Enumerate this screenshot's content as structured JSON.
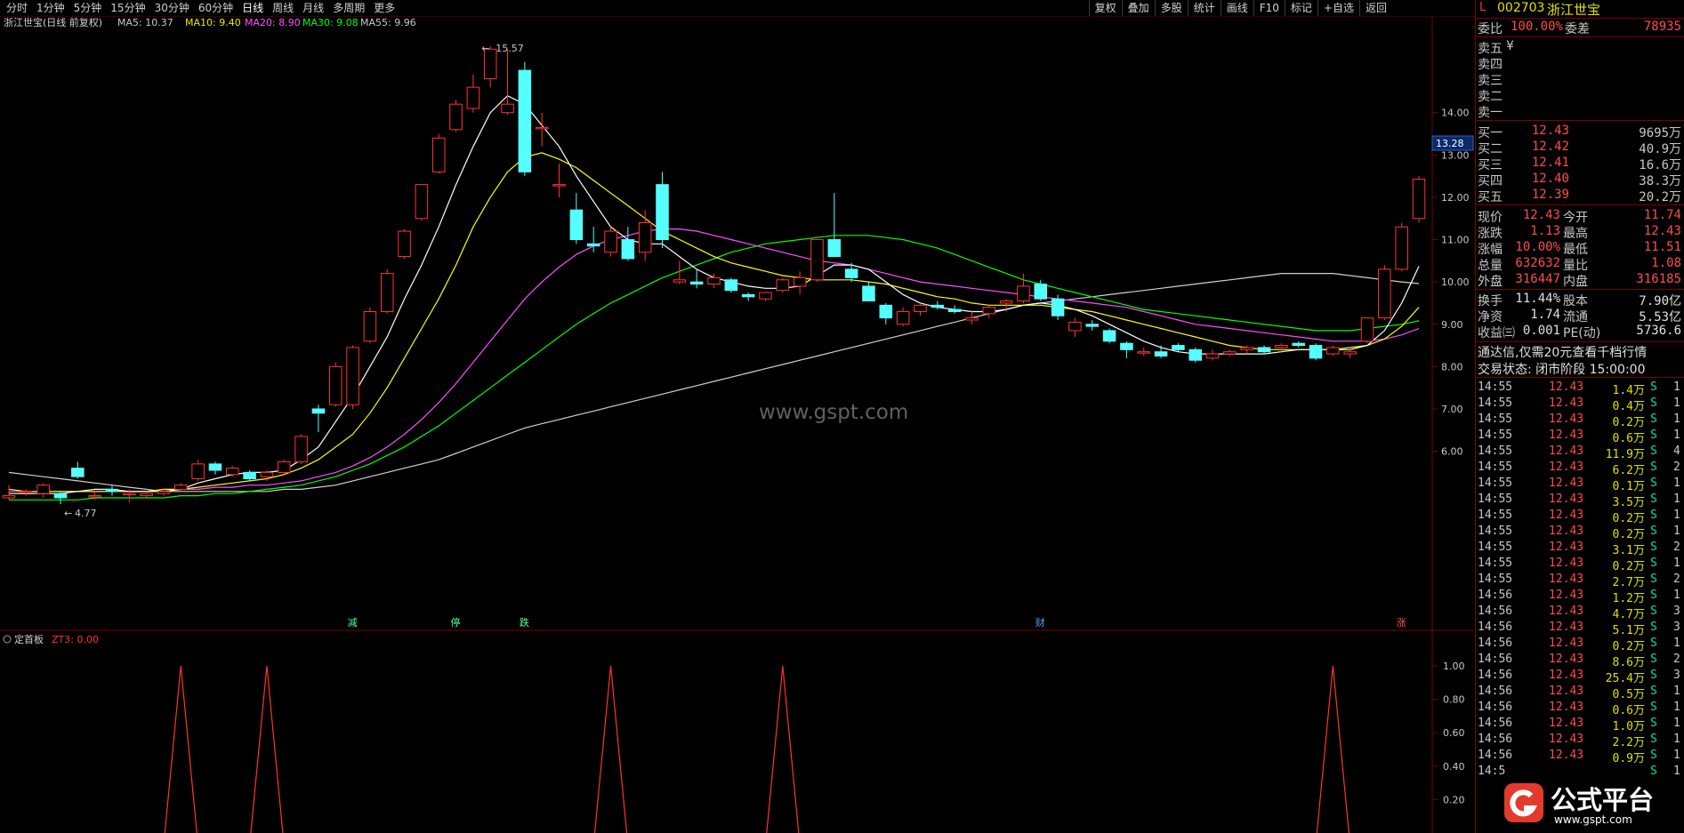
{
  "toolbar": {
    "periods": [
      "分时",
      "1分钟",
      "5分钟",
      "15分钟",
      "30分钟",
      "60分钟",
      "日线",
      "周线",
      "月线",
      "多周期",
      "更多"
    ],
    "active_period": "日线",
    "tools": [
      "复权",
      "叠加",
      "多股",
      "统计",
      "画线",
      "F10",
      "标记",
      "+自选",
      "返回"
    ]
  },
  "chart_header": {
    "title": "浙江世宝(日线 前复权)",
    "ma5": "MA5: 10.37",
    "ma10": "MA10: 9.40",
    "ma20": "MA20: 8.90",
    "ma30": "MA30: 9.08",
    "ma55": "MA55: 9.96"
  },
  "watermark": "www.gspt.com",
  "price_axis": [
    "14.00",
    "13.00",
    "12.00",
    "11.00",
    "10.00",
    "9.00",
    "8.00",
    "7.00",
    "6.00"
  ],
  "current_price_tag": "13.28",
  "high_label": "15.57",
  "low_label": "4.77",
  "markers": [
    "减",
    "停",
    "跌",
    "财",
    "涨"
  ],
  "indicator": {
    "name": "定首板",
    "value": "ZT3: 0.00",
    "axis": [
      "1.00",
      "0.80",
      "0.60",
      "0.40",
      "0.20"
    ]
  },
  "chart_data": {
    "type": "candlestick",
    "title": "浙江世宝(日线 前复权)",
    "candles": [
      [
        4.9,
        5.2,
        4.85,
        4.95
      ],
      [
        5.05,
        5.1,
        4.95,
        5.05
      ],
      [
        5.0,
        5.25,
        4.9,
        5.2
      ],
      [
        5.0,
        5.05,
        4.75,
        4.9
      ],
      [
        5.6,
        5.75,
        5.35,
        5.4
      ],
      [
        4.95,
        5.05,
        4.85,
        4.95
      ],
      [
        5.1,
        5.2,
        4.95,
        5.05
      ],
      [
        5.0,
        5.1,
        4.8,
        5.0
      ],
      [
        4.95,
        5.05,
        4.9,
        5.0
      ],
      [
        5.0,
        5.1,
        4.95,
        5.05
      ],
      [
        5.1,
        5.25,
        5.05,
        5.2
      ],
      [
        5.35,
        5.8,
        5.3,
        5.7
      ],
      [
        5.7,
        5.75,
        5.45,
        5.55
      ],
      [
        5.45,
        5.65,
        5.4,
        5.6
      ],
      [
        5.5,
        5.55,
        5.3,
        5.35
      ],
      [
        5.4,
        5.55,
        5.3,
        5.5
      ],
      [
        5.5,
        5.8,
        5.45,
        5.75
      ],
      [
        5.75,
        6.4,
        5.7,
        6.35
      ],
      [
        7.0,
        7.1,
        6.45,
        6.9
      ],
      [
        7.1,
        8.1,
        7.05,
        8.0
      ],
      [
        7.1,
        8.5,
        7.0,
        8.45
      ],
      [
        8.6,
        9.4,
        8.55,
        9.3
      ],
      [
        9.3,
        10.3,
        9.25,
        10.2
      ],
      [
        10.6,
        11.25,
        10.55,
        11.2
      ],
      [
        11.5,
        12.3,
        11.45,
        12.3
      ],
      [
        12.6,
        13.5,
        12.55,
        13.4
      ],
      [
        13.6,
        14.3,
        13.55,
        14.2
      ],
      [
        14.1,
        14.9,
        14.0,
        14.6
      ],
      [
        14.8,
        15.57,
        14.6,
        15.5
      ],
      [
        14.0,
        15.5,
        13.95,
        14.2
      ],
      [
        15.0,
        15.2,
        12.5,
        12.6
      ],
      [
        13.65,
        14.0,
        13.2,
        13.65
      ],
      [
        12.3,
        12.8,
        12.0,
        12.3
      ],
      [
        11.7,
        12.1,
        10.9,
        11.0
      ],
      [
        10.9,
        11.3,
        10.7,
        10.85
      ],
      [
        10.7,
        11.3,
        10.6,
        11.2
      ],
      [
        11.0,
        11.3,
        10.5,
        10.55
      ],
      [
        10.7,
        11.7,
        10.5,
        11.4
      ],
      [
        12.3,
        12.6,
        10.8,
        11.0
      ],
      [
        10.0,
        10.5,
        9.95,
        10.05
      ],
      [
        10.0,
        10.3,
        9.85,
        9.95
      ],
      [
        9.95,
        10.2,
        9.85,
        10.1
      ],
      [
        10.05,
        10.1,
        9.75,
        9.8
      ],
      [
        9.7,
        9.75,
        9.55,
        9.65
      ],
      [
        9.6,
        9.75,
        9.55,
        9.75
      ],
      [
        9.8,
        10.1,
        9.75,
        10.05
      ],
      [
        9.9,
        10.25,
        9.7,
        10.1
      ],
      [
        10.05,
        11.0,
        10.0,
        11.0
      ],
      [
        11.0,
        12.1,
        10.8,
        10.6
      ],
      [
        10.3,
        10.45,
        10.0,
        10.1
      ],
      [
        9.9,
        10.0,
        9.55,
        9.55
      ],
      [
        9.45,
        9.5,
        9.0,
        9.15
      ],
      [
        9.0,
        9.4,
        8.95,
        9.3
      ],
      [
        9.3,
        9.5,
        9.2,
        9.45
      ],
      [
        9.45,
        9.55,
        9.35,
        9.4
      ],
      [
        9.35,
        9.45,
        9.25,
        9.3
      ],
      [
        9.1,
        9.3,
        9.0,
        9.15
      ],
      [
        9.25,
        9.45,
        9.15,
        9.4
      ],
      [
        9.5,
        9.6,
        9.3,
        9.55
      ],
      [
        9.55,
        10.2,
        9.5,
        9.9
      ],
      [
        9.95,
        10.05,
        9.55,
        9.6
      ],
      [
        9.6,
        9.7,
        9.1,
        9.2
      ],
      [
        8.85,
        9.15,
        8.7,
        9.05
      ],
      [
        9.0,
        9.1,
        8.85,
        8.95
      ],
      [
        8.85,
        8.9,
        8.55,
        8.6
      ],
      [
        8.55,
        8.6,
        8.2,
        8.4
      ],
      [
        8.35,
        8.45,
        8.25,
        8.35
      ],
      [
        8.35,
        8.5,
        8.2,
        8.25
      ],
      [
        8.5,
        8.55,
        8.35,
        8.4
      ],
      [
        8.4,
        8.45,
        8.1,
        8.15
      ],
      [
        8.2,
        8.4,
        8.15,
        8.3
      ],
      [
        8.3,
        8.4,
        8.25,
        8.35
      ],
      [
        8.4,
        8.5,
        8.3,
        8.45
      ],
      [
        8.45,
        8.5,
        8.3,
        8.35
      ],
      [
        8.45,
        8.55,
        8.35,
        8.5
      ],
      [
        8.55,
        8.6,
        8.45,
        8.5
      ],
      [
        8.5,
        8.55,
        8.15,
        8.2
      ],
      [
        8.3,
        8.5,
        8.25,
        8.45
      ],
      [
        8.3,
        8.4,
        8.2,
        8.35
      ],
      [
        8.6,
        9.0,
        8.55,
        9.15
      ],
      [
        9.15,
        10.4,
        9.1,
        10.3
      ],
      [
        10.3,
        11.4,
        10.25,
        11.3
      ],
      [
        11.5,
        12.5,
        11.4,
        12.43
      ]
    ],
    "ma5": [
      5.0,
      5.0,
      5.0,
      5.0,
      5.05,
      5.1,
      5.1,
      5.05,
      5.05,
      5.05,
      5.1,
      5.25,
      5.35,
      5.45,
      5.5,
      5.5,
      5.55,
      5.8,
      6.1,
      6.7,
      7.3,
      8.0,
      8.7,
      9.6,
      10.4,
      11.3,
      12.3,
      13.2,
      14.0,
      14.4,
      14.2,
      13.7,
      13.2,
      12.5,
      11.9,
      11.3,
      11.0,
      10.9,
      10.9,
      10.6,
      10.3,
      10.1,
      10.0,
      9.9,
      9.85,
      9.85,
      9.9,
      10.15,
      10.4,
      10.4,
      10.3,
      10.0,
      9.7,
      9.5,
      9.4,
      9.35,
      9.3,
      9.3,
      9.35,
      9.45,
      9.5,
      9.45,
      9.35,
      9.2,
      9.0,
      8.8,
      8.6,
      8.45,
      8.35,
      8.3,
      8.3,
      8.3,
      8.3,
      8.3,
      8.35,
      8.4,
      8.4,
      8.4,
      8.4,
      8.5,
      8.85,
      9.5,
      10.37
    ],
    "ma10": [
      5.1,
      5.05,
      5.05,
      5.05,
      5.05,
      5.05,
      5.05,
      5.05,
      5.05,
      5.1,
      5.1,
      5.15,
      5.2,
      5.25,
      5.3,
      5.35,
      5.45,
      5.6,
      5.8,
      6.1,
      6.4,
      6.9,
      7.5,
      8.2,
      8.9,
      9.6,
      10.4,
      11.3,
      12.0,
      12.6,
      12.95,
      13.05,
      12.9,
      12.7,
      12.4,
      12.1,
      11.8,
      11.5,
      11.2,
      11.0,
      10.8,
      10.6,
      10.45,
      10.35,
      10.25,
      10.15,
      10.1,
      10.05,
      10.05,
      10.05,
      10.0,
      9.95,
      9.85,
      9.75,
      9.65,
      9.6,
      9.5,
      9.45,
      9.45,
      9.45,
      9.45,
      9.4,
      9.35,
      9.3,
      9.2,
      9.1,
      9.0,
      8.9,
      8.8,
      8.7,
      8.6,
      8.5,
      8.45,
      8.4,
      8.4,
      8.4,
      8.4,
      8.4,
      8.45,
      8.5,
      8.65,
      8.95,
      9.4
    ],
    "ma20": [
      5.05,
      5.05,
      5.05,
      5.05,
      5.05,
      5.05,
      5.05,
      5.05,
      5.05,
      5.05,
      5.1,
      5.1,
      5.15,
      5.15,
      5.2,
      5.2,
      5.25,
      5.3,
      5.4,
      5.5,
      5.65,
      5.85,
      6.1,
      6.4,
      6.75,
      7.15,
      7.6,
      8.1,
      8.6,
      9.1,
      9.6,
      10.0,
      10.35,
      10.65,
      10.85,
      11.0,
      11.1,
      11.2,
      11.25,
      11.25,
      11.2,
      11.1,
      11.0,
      10.9,
      10.8,
      10.7,
      10.6,
      10.5,
      10.45,
      10.4,
      10.3,
      10.2,
      10.1,
      10.0,
      9.95,
      9.9,
      9.85,
      9.8,
      9.75,
      9.7,
      9.65,
      9.6,
      9.55,
      9.5,
      9.45,
      9.4,
      9.3,
      9.2,
      9.1,
      9.0,
      8.95,
      8.9,
      8.85,
      8.8,
      8.75,
      8.7,
      8.65,
      8.6,
      8.6,
      8.6,
      8.65,
      8.75,
      8.9
    ],
    "ma30": [
      4.85,
      4.85,
      4.85,
      4.85,
      4.85,
      4.9,
      4.9,
      4.9,
      4.9,
      4.9,
      4.95,
      4.95,
      5.0,
      5.0,
      5.05,
      5.1,
      5.15,
      5.2,
      5.3,
      5.4,
      5.55,
      5.7,
      5.9,
      6.1,
      6.35,
      6.6,
      6.9,
      7.2,
      7.5,
      7.8,
      8.1,
      8.4,
      8.7,
      9.0,
      9.25,
      9.5,
      9.7,
      9.9,
      10.1,
      10.25,
      10.4,
      10.55,
      10.7,
      10.8,
      10.9,
      10.95,
      11.0,
      11.05,
      11.1,
      11.1,
      11.1,
      11.05,
      11.0,
      10.9,
      10.8,
      10.65,
      10.5,
      10.35,
      10.2,
      10.05,
      9.95,
      9.85,
      9.75,
      9.65,
      9.55,
      9.45,
      9.35,
      9.3,
      9.25,
      9.2,
      9.15,
      9.1,
      9.05,
      9.0,
      8.95,
      8.9,
      8.85,
      8.85,
      8.85,
      8.9,
      8.95,
      9.0,
      9.08
    ],
    "ma55": [
      5.5,
      5.45,
      5.4,
      5.35,
      5.3,
      5.25,
      5.2,
      5.15,
      5.1,
      5.05,
      5.05,
      5.05,
      5.05,
      5.05,
      5.05,
      5.05,
      5.1,
      5.1,
      5.15,
      5.2,
      5.3,
      5.4,
      5.5,
      5.6,
      5.7,
      5.8,
      5.95,
      6.1,
      6.25,
      6.4,
      6.55,
      6.65,
      6.75,
      6.85,
      6.95,
      7.05,
      7.15,
      7.25,
      7.35,
      7.45,
      7.55,
      7.65,
      7.75,
      7.85,
      7.95,
      8.05,
      8.15,
      8.25,
      8.35,
      8.45,
      8.55,
      8.65,
      8.75,
      8.85,
      8.95,
      9.05,
      9.15,
      9.25,
      9.35,
      9.45,
      9.5,
      9.55,
      9.6,
      9.65,
      9.7,
      9.75,
      9.8,
      9.85,
      9.9,
      9.95,
      10.0,
      10.05,
      10.1,
      10.15,
      10.2,
      10.2,
      10.2,
      10.2,
      10.15,
      10.1,
      10.05,
      10.0,
      9.96
    ],
    "zt3_spikes": [
      10,
      15,
      35,
      45,
      77
    ],
    "ylim": [
      4.5,
      15.8
    ]
  },
  "right_panel": {
    "header_flag": "L",
    "code": "002703",
    "name": "浙江世宝",
    "weibi_label": "委比",
    "weibi_value": "100.00%",
    "weicha_label": "委差",
    "weicha_value": "78935",
    "sell_rows": [
      {
        "label": "卖五",
        "price": "",
        "vol": ""
      },
      {
        "label": "卖四",
        "price": "",
        "vol": ""
      },
      {
        "label": "卖三",
        "price": "",
        "vol": ""
      },
      {
        "label": "卖二",
        "price": "",
        "vol": ""
      },
      {
        "label": "卖一",
        "price": "",
        "vol": ""
      }
    ],
    "sell_yen": "¥",
    "buy_rows": [
      {
        "label": "买一",
        "price": "12.43",
        "vol": "9695万"
      },
      {
        "label": "买二",
        "price": "12.42",
        "vol": "40.9万"
      },
      {
        "label": "买三",
        "price": "12.41",
        "vol": "16.6万"
      },
      {
        "label": "买四",
        "price": "12.40",
        "vol": "38.3万"
      },
      {
        "label": "买五",
        "price": "12.39",
        "vol": "20.2万"
      }
    ],
    "stats": [
      {
        "l1": "现价",
        "v1": "12.43",
        "l2": "今开",
        "v2": "11.74"
      },
      {
        "l1": "涨跌",
        "v1": "1.13",
        "l2": "最高",
        "v2": "12.43"
      },
      {
        "l1": "涨幅",
        "v1": "10.00%",
        "l2": "最低",
        "v2": "11.51"
      },
      {
        "l1": "总量",
        "v1": "632632",
        "l2": "量比",
        "v2": "1.08"
      },
      {
        "l1": "外盘",
        "v1": "316447",
        "l2": "内盘",
        "v2": "316185"
      }
    ],
    "fundamentals": [
      {
        "l1": "换手",
        "v1": "11.44%",
        "l2": "股本",
        "v2": "7.90亿"
      },
      {
        "l1": "净资",
        "v1": "1.74",
        "l2": "流通",
        "v2": "5.53亿"
      },
      {
        "l1": "收益㈢",
        "v1": "0.001",
        "l2": "PE(动)",
        "v2": "5736.6"
      }
    ],
    "promo": "通达信,仅需20元查看千档行情",
    "trade_state": "交易状态: 闭市阶段 15:00:00",
    "ticks": [
      {
        "t": "14:55",
        "p": "12.43",
        "q": "1.4万",
        "s": "S",
        "n": "1"
      },
      {
        "t": "14:55",
        "p": "12.43",
        "q": "0.4万",
        "s": "S",
        "n": "1"
      },
      {
        "t": "14:55",
        "p": "12.43",
        "q": "0.2万",
        "s": "S",
        "n": "1"
      },
      {
        "t": "14:55",
        "p": "12.43",
        "q": "0.6万",
        "s": "S",
        "n": "1"
      },
      {
        "t": "14:55",
        "p": "12.43",
        "q": "11.9万",
        "s": "S",
        "n": "4"
      },
      {
        "t": "14:55",
        "p": "12.43",
        "q": "6.2万",
        "s": "S",
        "n": "2"
      },
      {
        "t": "14:55",
        "p": "12.43",
        "q": "0.1万",
        "s": "S",
        "n": "1"
      },
      {
        "t": "14:55",
        "p": "12.43",
        "q": "3.5万",
        "s": "S",
        "n": "1"
      },
      {
        "t": "14:55",
        "p": "12.43",
        "q": "0.2万",
        "s": "S",
        "n": "1"
      },
      {
        "t": "14:55",
        "p": "12.43",
        "q": "0.2万",
        "s": "S",
        "n": "1"
      },
      {
        "t": "14:55",
        "p": "12.43",
        "q": "3.1万",
        "s": "S",
        "n": "2"
      },
      {
        "t": "14:55",
        "p": "12.43",
        "q": "0.2万",
        "s": "S",
        "n": "1"
      },
      {
        "t": "14:55",
        "p": "12.43",
        "q": "2.7万",
        "s": "S",
        "n": "2"
      },
      {
        "t": "14:56",
        "p": "12.43",
        "q": "1.2万",
        "s": "S",
        "n": "1"
      },
      {
        "t": "14:56",
        "p": "12.43",
        "q": "4.7万",
        "s": "S",
        "n": "3"
      },
      {
        "t": "14:56",
        "p": "12.43",
        "q": "5.1万",
        "s": "S",
        "n": "3"
      },
      {
        "t": "14:56",
        "p": "12.43",
        "q": "0.2万",
        "s": "S",
        "n": "1"
      },
      {
        "t": "14:56",
        "p": "12.43",
        "q": "8.6万",
        "s": "S",
        "n": "2"
      },
      {
        "t": "14:56",
        "p": "12.43",
        "q": "25.4万",
        "s": "S",
        "n": "3"
      },
      {
        "t": "14:56",
        "p": "12.43",
        "q": "0.5万",
        "s": "S",
        "n": "1"
      },
      {
        "t": "14:56",
        "p": "12.43",
        "q": "0.6万",
        "s": "S",
        "n": "1"
      },
      {
        "t": "14:56",
        "p": "12.43",
        "q": "1.0万",
        "s": "S",
        "n": "1"
      },
      {
        "t": "14:56",
        "p": "12.43",
        "q": "2.2万",
        "s": "S",
        "n": "1"
      },
      {
        "t": "14:56",
        "p": "12.43",
        "q": "0.9万",
        "s": "S",
        "n": "1"
      },
      {
        "t": "14:5",
        "p": "",
        "q": "",
        "s": "S",
        "n": "1"
      }
    ]
  },
  "brand": {
    "name": "公式平台",
    "url": "www.gspt.com"
  },
  "colors": {
    "up": "#ff3333",
    "down": "#54ffff",
    "ma5": "#ffffff",
    "ma10": "#ffff00",
    "ma20": "#ff4dff",
    "ma30": "#00ff00",
    "ma55": "#d0d0d0",
    "border": "#7a0000"
  }
}
